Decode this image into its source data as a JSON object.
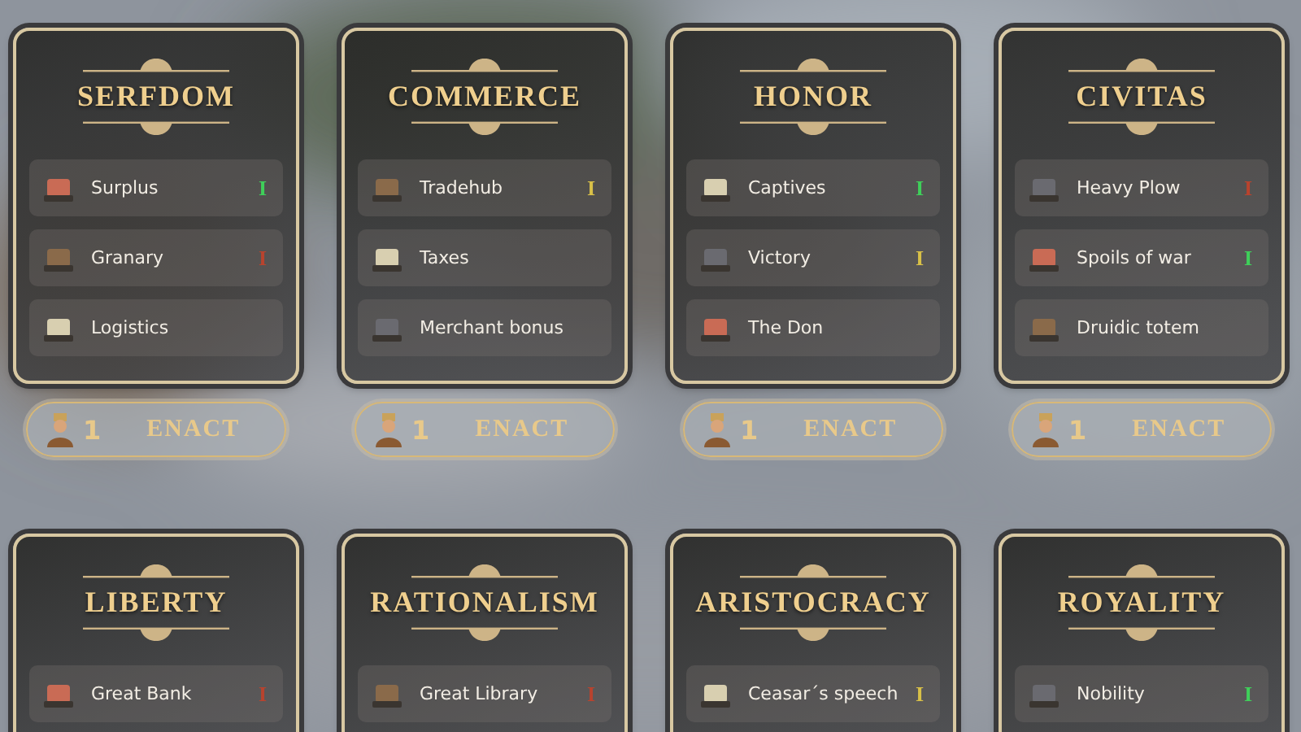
{
  "policy_cards": [
    {
      "title": "SERFDOM",
      "items": [
        {
          "label": "Surplus",
          "tier": "I",
          "color": "#3fcf5a"
        },
        {
          "label": "Granary",
          "tier": "I",
          "color": "#b8432e"
        },
        {
          "label": "Logistics"
        }
      ],
      "enact": {
        "cost": "1",
        "label": "ENACT"
      }
    },
    {
      "title": "COMMERCE",
      "items": [
        {
          "label": "Tradehub",
          "tier": "I",
          "color": "#d8c048"
        },
        {
          "label": "Taxes"
        },
        {
          "label": "Merchant bonus"
        }
      ],
      "enact": {
        "cost": "1",
        "label": "ENACT"
      }
    },
    {
      "title": "HONOR",
      "items": [
        {
          "label": "Captives",
          "tier": "I",
          "color": "#3fcf5a"
        },
        {
          "label": "Victory",
          "tier": "I",
          "color": "#d8c048"
        },
        {
          "label": "The Don"
        }
      ],
      "enact": {
        "cost": "1",
        "label": "ENACT"
      }
    },
    {
      "title": "CIVITAS",
      "items": [
        {
          "label": "Heavy Plow",
          "tier": "I",
          "color": "#b8432e"
        },
        {
          "label": "Spoils of war",
          "tier": "I",
          "color": "#3fcf5a"
        },
        {
          "label": "Druidic totem"
        }
      ],
      "enact": {
        "cost": "1",
        "label": "ENACT"
      }
    },
    {
      "title": "LIBERTY",
      "items": [
        {
          "label": "Great Bank",
          "tier": "I",
          "color": "#b8432e"
        }
      ]
    },
    {
      "title": "RATIONALISM",
      "items": [
        {
          "label": "Great Library",
          "tier": "I",
          "color": "#b8432e"
        }
      ]
    },
    {
      "title": "ARISTOCRACY",
      "items": [
        {
          "label": "Ceasar´s speech",
          "tier": "I",
          "color": "#d8c048"
        }
      ]
    },
    {
      "title": "ROYALITY",
      "items": [
        {
          "label": "Nobility",
          "tier": "I",
          "color": "#3fcf5a"
        }
      ]
    }
  ]
}
